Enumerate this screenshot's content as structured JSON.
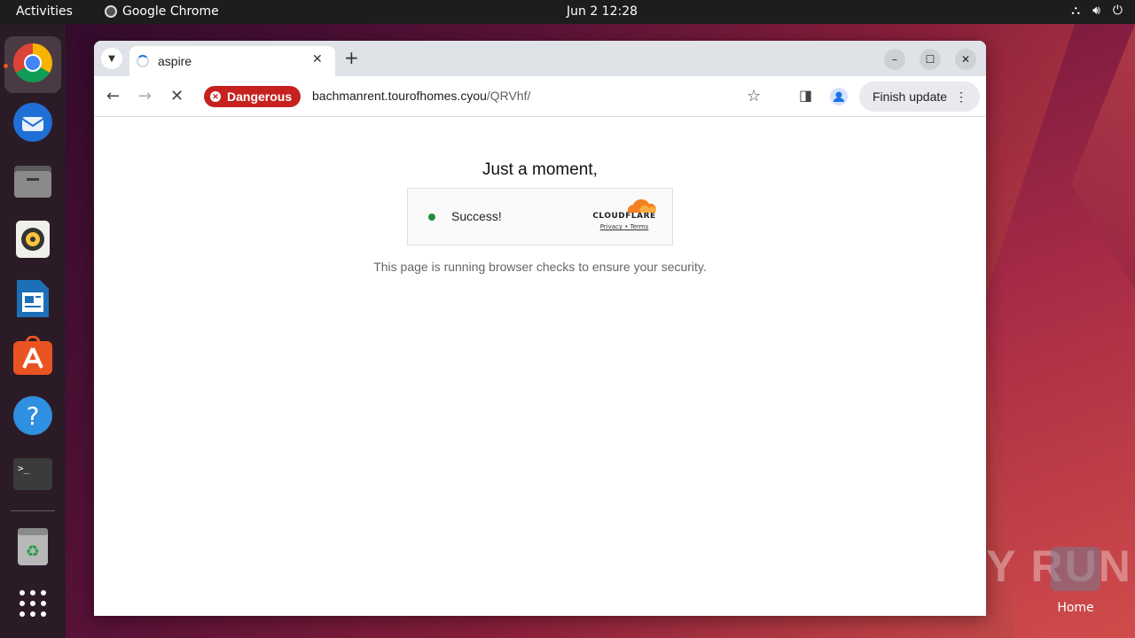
{
  "topbar": {
    "activities": "Activities",
    "app_name": "Google Chrome",
    "clock": "Jun 2  12:28"
  },
  "browser": {
    "tab_title": "aspire",
    "security_badge": "Dangerous",
    "url_host": "bachmanrent.tourofhomes.cyou",
    "url_path": "/QRVhf/",
    "finish_update": "Finish update"
  },
  "page": {
    "heading": "Just a moment,",
    "widget_status": "Success!",
    "widget_brand": "CLOUDFLARE",
    "widget_privacy": "Privacy",
    "widget_terms": "Terms",
    "note": "This page is running browser checks to ensure your security."
  },
  "desktop": {
    "home_label": "Home",
    "watermark": "ANY RUN"
  },
  "colors": {
    "danger": "#c5221f",
    "success": "#1e8e3e",
    "cloudflare_orange": "#f48120"
  }
}
